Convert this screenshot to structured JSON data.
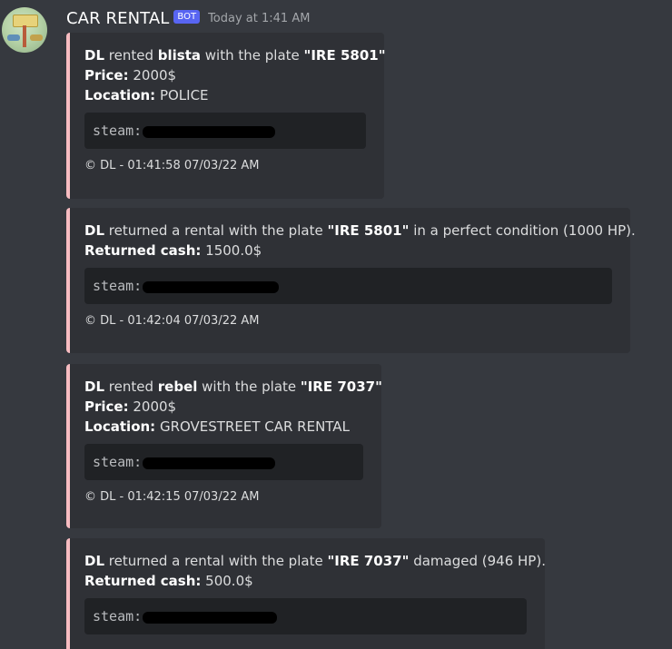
{
  "message": {
    "username": "CAR RENTAL",
    "bot_tag": "BOT",
    "timestamp": "Today at 1:41 AM"
  },
  "accent_color": "#f7bcc1",
  "embeds": [
    {
      "actor": "DL",
      "t1": " rented ",
      "vehicle": "blista",
      "t2": " with the plate ",
      "plate": "\"IRE 5801\"",
      "price_label": "Price:",
      "price_value": " 2000$",
      "location_label": "Location:",
      "location_value": " POLICE",
      "code_text": "steam:",
      "footer": "© DL - 01:41:58 07/03/22 AM"
    },
    {
      "actor": "DL",
      "t1": " returned a rental with the plate ",
      "plate": "\"IRE 5801\"",
      "t2": " in a perfect condition (1000 HP).",
      "cash_label": "Returned cash:",
      "cash_value": " 1500.0$",
      "code_text": "steam:",
      "footer": "© DL - 01:42:04 07/03/22 AM"
    },
    {
      "actor": "DL",
      "t1": " rented ",
      "vehicle": "rebel",
      "t2": " with the plate ",
      "plate": "\"IRE 7037\"",
      "price_label": "Price:",
      "price_value": " 2000$",
      "location_label": "Location:",
      "location_value": " GROVESTREET CAR RENTAL",
      "code_text": "steam:",
      "footer": "© DL - 01:42:15 07/03/22 AM"
    },
    {
      "actor": "DL",
      "t1": " returned a rental with the plate ",
      "plate": "\"IRE 7037\"",
      "t2": " damaged (946 HP).",
      "cash_label": "Returned cash:",
      "cash_value": " 500.0$",
      "code_text": "steam:"
    }
  ]
}
